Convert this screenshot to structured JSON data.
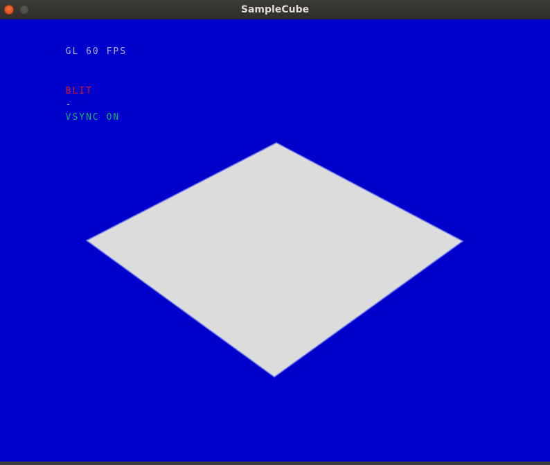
{
  "window": {
    "title": "SampleCube"
  },
  "colors": {
    "background": "#0000cd",
    "plane_fill": "#dcdcdc",
    "plane_edge": "#6f78e6",
    "hud_gray": "#b4b4dc",
    "hud_red": "#e21818",
    "hud_green": "#14b464",
    "hud_dash": "#c8c8e6"
  },
  "hud": {
    "line1": "GL 60 FPS",
    "mode": "BLIT",
    "separator": "-",
    "vsync": "VSYNC ON"
  },
  "scene": {
    "object": "cube-top-face"
  }
}
